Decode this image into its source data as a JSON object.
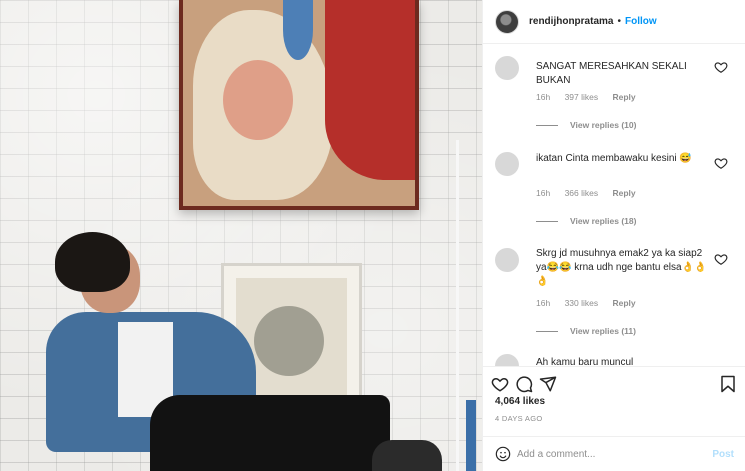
{
  "header": {
    "username": "rendijhonpratama",
    "separator": "•",
    "follow_label": "Follow"
  },
  "comments": [
    {
      "text": "SANGAT MERESAHKAN SEKALI BUKAN",
      "time": "16h",
      "likes": "397 likes",
      "reply_label": "Reply",
      "view_replies": "View replies (10)"
    },
    {
      "text": "ikatan Cinta membawaku kesini 😅",
      "time": "16h",
      "likes": "366 likes",
      "reply_label": "Reply",
      "view_replies": "View replies (18)"
    },
    {
      "text": "Skrg jd musuhnya emak2 ya ka siap2 ya😂😂 krna udh nge bantu elsa👌👌👌",
      "time": "16h",
      "likes": "330 likes",
      "reply_label": "Reply",
      "view_replies": "View replies (11)"
    },
    {
      "text": "Ah kamu baru muncul"
    }
  ],
  "post": {
    "likes": "4,064 likes",
    "date": "4 DAYS AGO"
  },
  "comment_box": {
    "placeholder": "Add a comment...",
    "post_label": "Post"
  },
  "colors": {
    "accent": "#0095f6",
    "post_disabled": "#b2dffc",
    "muted": "#8e8e8e"
  }
}
